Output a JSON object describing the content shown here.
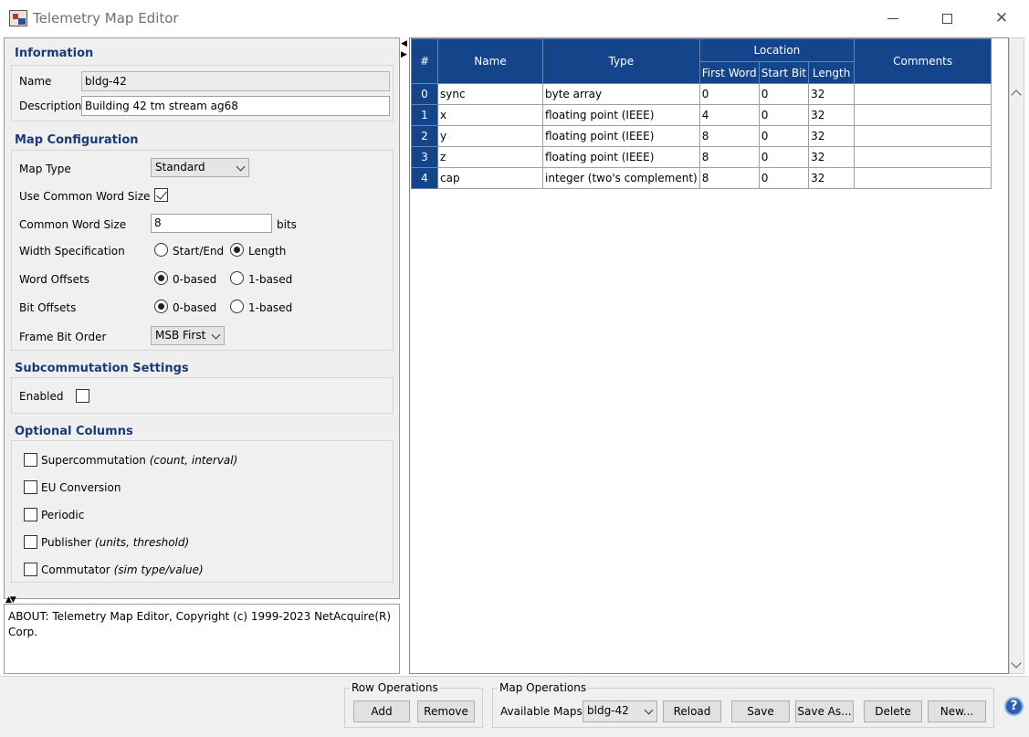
{
  "window": {
    "title": "Telemetry Map Editor"
  },
  "information": {
    "heading": "Information",
    "name_label": "Name",
    "name_value": "bldg-42",
    "description_label": "Description",
    "description_value": "Building 42 tm stream ag68"
  },
  "map_config": {
    "heading": "Map Configuration",
    "map_type_label": "Map Type",
    "map_type_value": "Standard",
    "use_common_label": "Use Common Word Size",
    "use_common_checked": true,
    "common_word_label": "Common Word Size",
    "common_word_value": "8",
    "common_word_unit": "bits",
    "width_spec_label": "Width Specification",
    "width_spec_opt1": "Start/End",
    "width_spec_opt2": "Length",
    "width_spec_selected": "Length",
    "word_offsets_label": "Word Offsets",
    "word_offsets_opt1": "0-based",
    "word_offsets_opt2": "1-based",
    "word_offsets_selected": "0-based",
    "bit_offsets_label": "Bit Offsets",
    "bit_offsets_opt1": "0-based",
    "bit_offsets_opt2": "1-based",
    "bit_offsets_selected": "0-based",
    "frame_bit_order_label": "Frame Bit Order",
    "frame_bit_order_value": "MSB First"
  },
  "subcomm": {
    "heading": "Subcommutation Settings",
    "enabled_label": "Enabled",
    "enabled_checked": false
  },
  "optional_columns": {
    "heading": "Optional Columns",
    "items": [
      {
        "label": "Supercommutation ",
        "hint": "(count, interval)",
        "checked": false
      },
      {
        "label": "EU Conversion",
        "hint": "",
        "checked": false
      },
      {
        "label": "Periodic",
        "hint": "",
        "checked": false
      },
      {
        "label": "Publisher ",
        "hint": "(units, threshold)",
        "checked": false
      },
      {
        "label": "Commutator ",
        "hint": "(sim type/value)",
        "checked": false
      }
    ]
  },
  "about": {
    "text": "ABOUT: Telemetry Map Editor, Copyright (c) 1999-2023 NetAcquire(R) Corp."
  },
  "table": {
    "headers": {
      "index": "#",
      "name": "Name",
      "type": "Type",
      "location": "Location",
      "first_word": "First Word",
      "start_bit": "Start Bit",
      "length": "Length",
      "comments": "Comments"
    },
    "rows": [
      {
        "index": "0",
        "name": "sync",
        "type": "byte array",
        "first_word": "0",
        "start_bit": "0",
        "length": "32",
        "comments": ""
      },
      {
        "index": "1",
        "name": "x",
        "type": "floating point (IEEE)",
        "first_word": "4",
        "start_bit": "0",
        "length": "32",
        "comments": ""
      },
      {
        "index": "2",
        "name": "y",
        "type": "floating point (IEEE)",
        "first_word": "8",
        "start_bit": "0",
        "length": "32",
        "comments": ""
      },
      {
        "index": "3",
        "name": "z",
        "type": "floating point (IEEE)",
        "first_word": "8",
        "start_bit": "0",
        "length": "32",
        "comments": ""
      },
      {
        "index": "4",
        "name": "cap",
        "type": "integer (two's complement)",
        "first_word": "8",
        "start_bit": "0",
        "length": "32",
        "comments": ""
      }
    ]
  },
  "row_ops": {
    "legend": "Row Operations",
    "add_label": "Add",
    "remove_label": "Remove"
  },
  "map_ops": {
    "legend": "Map Operations",
    "available_label": "Available Maps",
    "available_value": "bldg-42",
    "reload_label": "Reload",
    "save_label": "Save",
    "save_as_label": "Save As...",
    "delete_label": "Delete",
    "new_label": "New..."
  },
  "help": {
    "glyph": "?"
  },
  "colors": {
    "accent": "#14448a",
    "heading": "#1b3a78"
  }
}
